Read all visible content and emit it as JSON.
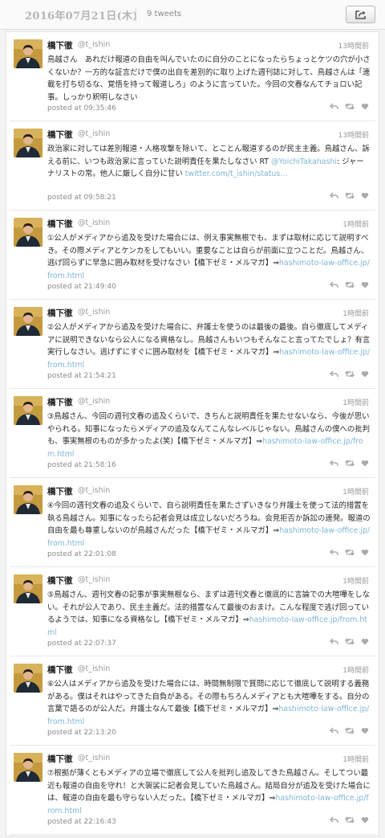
{
  "header": {
    "date": "2016年07月21日(木)",
    "tweet_count": "9 tweets"
  },
  "icons": {
    "share": "share-icon",
    "reply": "reply-icon",
    "retweet": "retweet-icon",
    "favorite": "heart-icon"
  },
  "colors": {
    "link": "#7fb6d6",
    "date": "#b5b5b5",
    "background": "#f4f4f4"
  },
  "tweets": [
    {
      "name": "橋下徹",
      "handle": "@t_ishin",
      "reltime": "13時間前",
      "segments": [
        {
          "t": "鳥越さん　あれだけ報道の自由を叫んでいたのに自分のことになったらちょっとケツの穴が小さくないか？一方的な証言だけで僕の出自を差別的に取り上げた週刊誌に対して、鳥越さんは「連載を打ち切るな、覚悟を持って報道しろ」のように言っていた。今回の文春なんてチョロい記事。しっかり釈明しなさい"
        }
      ],
      "posted": "posted at 09:35:46"
    },
    {
      "name": "橋下徹",
      "handle": "@t_ishin",
      "reltime": "13時間前",
      "segments": [
        {
          "t": "政治家に対しては差別報道・人格攻撃を除いて、とことん報道するのが民主主義。鳥越さん、訴える前に、いつも政治家に言っていた説明責任を果たしなさい RT "
        },
        {
          "t": "@YoichiTakahashi",
          "link": true
        },
        {
          "t": ": ジャーナリストの常。他人に厳しく自分に甘い "
        },
        {
          "t": "twitter.com/t_ishin/status…",
          "link": true
        }
      ],
      "posted": "posted at 09:58:21"
    },
    {
      "name": "橋下徹",
      "handle": "@t_ishin",
      "reltime": "1時間前",
      "segments": [
        {
          "t": "①公人がメディアから追及を受けた場合には、例え事実無根でも、まずは取材に応じて説明すべき。その際メディアとケンカをしてもいい。重要なことは自らが前面に立つことだ。鳥越さん、逃げ回らずに早急に囲み取材を受けなさい【橋下ゼミ・メルマガ】⇒"
        },
        {
          "t": "hashimoto-law-office.jp/from.html",
          "link": true
        }
      ],
      "posted": "posted at 21:49:40"
    },
    {
      "name": "橋下徹",
      "handle": "@t_ishin",
      "reltime": "1時間前",
      "segments": [
        {
          "t": "②公人がメディアから追及を受けた場合に、弁護士を使うのは最後の最後。自ら徹底してメディアに説明できないなら公人になる資格なし。鳥越さんもいつもそんなこと言ってたでしょ？有言実行しなさい。逃げずにすぐに囲み取材を【橋下ゼミ・メルマガ】⇒"
        },
        {
          "t": "hashimoto-law-office.jp/from.html",
          "link": true
        }
      ],
      "posted": "posted at 21:54:21"
    },
    {
      "name": "橋下徹",
      "handle": "@t_ishin",
      "reltime": "1時間前",
      "segments": [
        {
          "t": "③鳥越さん、今回の週刊文春の追及くらいで、きちんと説明責任を果たせないなら、今後が思いやられる。知事になったらメディアの追及なんてこんなレベルじゃない。鳥越さんの僕への批判も、事実無根のものが多かったよ(笑)【橋下ゼミ・メルマガ】⇒"
        },
        {
          "t": "hashimoto-law-office.jp/from.html",
          "link": true
        }
      ],
      "posted": "posted at 21:58:16"
    },
    {
      "name": "橋下徹",
      "handle": "@t_ishin",
      "reltime": "1時間前",
      "segments": [
        {
          "t": "④今回の週刊文春の追及くらいで、自ら説明責任を果たさずいきなり弁護士を使って法的措置を執る鳥越さん。知事になったら記者会見は成立しないだろうね。会見拒否か訴訟の連発。報道の自由を最も尊重しないのが鳥越さんだった【橋下ゼミ・メルマガ】⇒"
        },
        {
          "t": "hashimoto-law-office.jp/from.html",
          "link": true
        }
      ],
      "posted": "posted at 22:01:08"
    },
    {
      "name": "橋下徹",
      "handle": "@t_ishin",
      "reltime": "1時間前",
      "segments": [
        {
          "t": "⑤鳥越さん、週刊文春の記事が事実無根なら、まずは週刊文春と徹底的に言論での大喧嘩をしない。それが公人であり、民主主義だ。法的措置なんて最後のおまけ。こんな程度で逃げ回っているようでは、知事になる資格なし【橋下ゼミ・メルマガ】⇒"
        },
        {
          "t": "hashimoto-law-office.jp/from.html",
          "link": true
        }
      ],
      "posted": "posted at 22:07:37"
    },
    {
      "name": "橋下徹",
      "handle": "@t_ishin",
      "reltime": "1時間前",
      "segments": [
        {
          "t": "⑥公人はメディアから追及を受けた場合には、時間無制限で質問に応じて徹底して説明する義務がある。僕はそれはやってきた自負がある。その際もちろんメディアとも大喧嘩をする。自分の言葉で語るのが公人だ。弁護士なんて最後【橋下ゼミ・メルマガ】⇒"
        },
        {
          "t": "hashimoto-law-office.jp/from.html",
          "link": true
        }
      ],
      "posted": "posted at 22:13:20"
    },
    {
      "name": "橋下徹",
      "handle": "@t_ishin",
      "reltime": "1時間前",
      "segments": [
        {
          "t": "⑦根拠が薄くともメディアの立場で徹底して公人を批判し追及してきた鳥越さん。そしてつい最近も報道の自由を守れ！と大袈裟に記者会見していた鳥越さん。結局自分が追及を受けた場合には、報道の自由を最も守らない人だった。【橋下ゼミ・メルマガ】⇒"
        },
        {
          "t": "hashimoto-law-office.jp/from.html",
          "link": true
        }
      ],
      "posted": "posted at 22:16:43"
    }
  ]
}
